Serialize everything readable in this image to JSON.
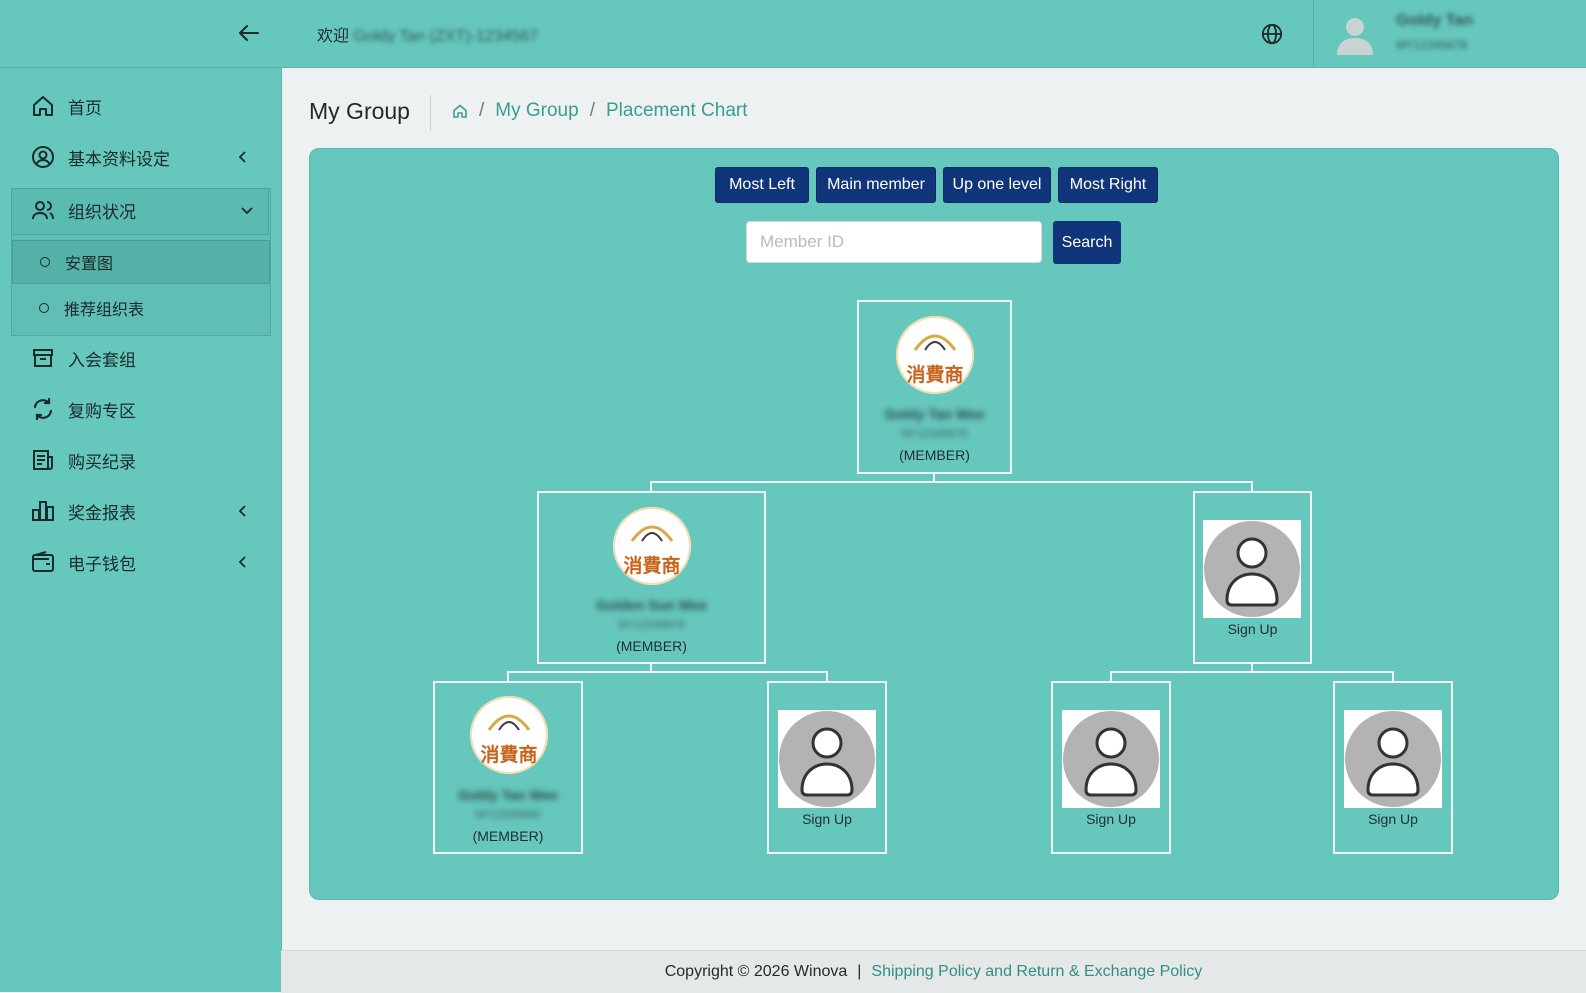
{
  "sidebar": {
    "items": [
      {
        "label": "首页",
        "icon": "home-icon"
      },
      {
        "label": "基本资料设定",
        "icon": "user-circle-icon"
      },
      {
        "label": "组织状况",
        "icon": "users-icon"
      },
      {
        "label": "入会套组",
        "icon": "archive-icon"
      },
      {
        "label": "复购专区",
        "icon": "refresh-icon"
      },
      {
        "label": "购买纪录",
        "icon": "receipt-icon"
      },
      {
        "label": "奖金报表",
        "icon": "bar-chart-icon"
      },
      {
        "label": "电子钱包",
        "icon": "wallet-icon"
      }
    ],
    "subitems": [
      {
        "label": "安置图"
      },
      {
        "label": "推荐组织表"
      }
    ]
  },
  "header": {
    "welcome": "欢迎",
    "welcome_user": "Goldy Tan (ZXT)-1234567",
    "user_name": "Goldy Tan",
    "user_id": "MY12345678"
  },
  "page": {
    "title": "My Group",
    "breadcrumb": [
      "My Group",
      "Placement Chart"
    ]
  },
  "controls": {
    "buttons": [
      "Most Left",
      "Main member",
      "Up one level",
      "Most Right"
    ],
    "search_placeholder": "Member ID",
    "search_label": "Search"
  },
  "tree": {
    "logo_text": "消費商",
    "root": {
      "name": "Goldy Tan Wee",
      "id": "MY12345678",
      "role": "(MEMBER)"
    },
    "left": {
      "name": "Golden Sun Wee",
      "id": "MY12345679",
      "role": "(MEMBER)"
    },
    "right": {
      "label": "Sign Up"
    },
    "left_left": {
      "name": "Goldy Tan Wee",
      "id": "MY12345680",
      "role": "(MEMBER)"
    },
    "left_right": {
      "label": "Sign Up"
    },
    "right_left": {
      "label": "Sign Up"
    },
    "right_right": {
      "label": "Sign Up"
    }
  },
  "footer": {
    "copyright": "Copyright © 2026 Winova",
    "separator": "|",
    "policy_link": "Shipping Policy and Return & Exchange Policy"
  },
  "colors": {
    "teal": "#66c7bd",
    "navy_button": "#11357a",
    "link": "#3a9d92"
  }
}
